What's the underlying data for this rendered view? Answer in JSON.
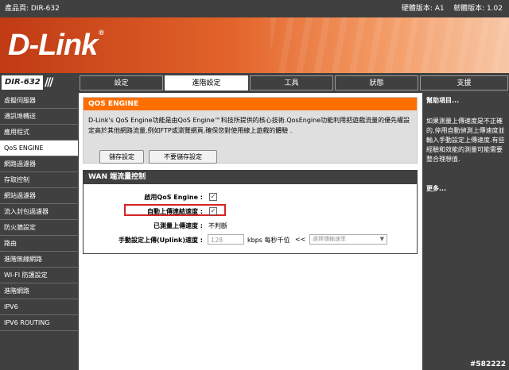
{
  "topbar": {
    "product": "產品頁: DIR-632",
    "version": "硬體版本: A1    韌體版本: 1.02"
  },
  "logo": {
    "text": "D-Link",
    "mark": "®"
  },
  "model": "DIR-632",
  "tabs": [
    "設定",
    "進階設定",
    "工具",
    "狀態",
    "支援"
  ],
  "active_tab": "進階設定",
  "sidebar": {
    "items": [
      "虛擬伺服器",
      "通訊埠轉送",
      "應用程式",
      "QoS ENGINE",
      "網路過濾器",
      "存取控制",
      "網站過濾器",
      "流入封包過濾器",
      "防火牆設定",
      "路由",
      "進階無線網路",
      "WI-FI 防護設定",
      "進階網路",
      "IPV6",
      "IPV6 ROUTING"
    ],
    "active": "QoS ENGINE"
  },
  "qos_box": {
    "header": "QOS ENGINE",
    "description": "D-Link's QoS Engine功能是由QoS Engine™科技所提供的核心技術.QosEngine功能利用把遊戲流量的優先權設定高於其他網路流量,例如FTP或瀏覽網頁,確保您對使用線上遊戲的體驗 .",
    "save_label": "儲存設定",
    "dont_save_label": "不要儲存設定"
  },
  "wan_box": {
    "header": "WAN 端流量控制",
    "enable_label": "啟用QoS Engine :",
    "enable_checked": true,
    "auto_label": "自動上傳連結速度 :",
    "auto_checked": true,
    "measured_label": "已測量上傳速度 :",
    "measured_value": "不判斷",
    "manual_label": "手動設定上傳(Uplink)速度 :",
    "manual_value": "128",
    "unit": "kbps 每秒千位",
    "arrows": "<<",
    "select_placeholder": "選擇傳輸速率"
  },
  "help": {
    "title": "幫助項目...",
    "text": "如果測量上傳速度是不正確的,停用自動偵測上傳速度並輸入手動設定上傳速度.有些經驗和效能的測量可能需要整合理想值.",
    "more": "更多..."
  },
  "watermark": "#582222"
}
